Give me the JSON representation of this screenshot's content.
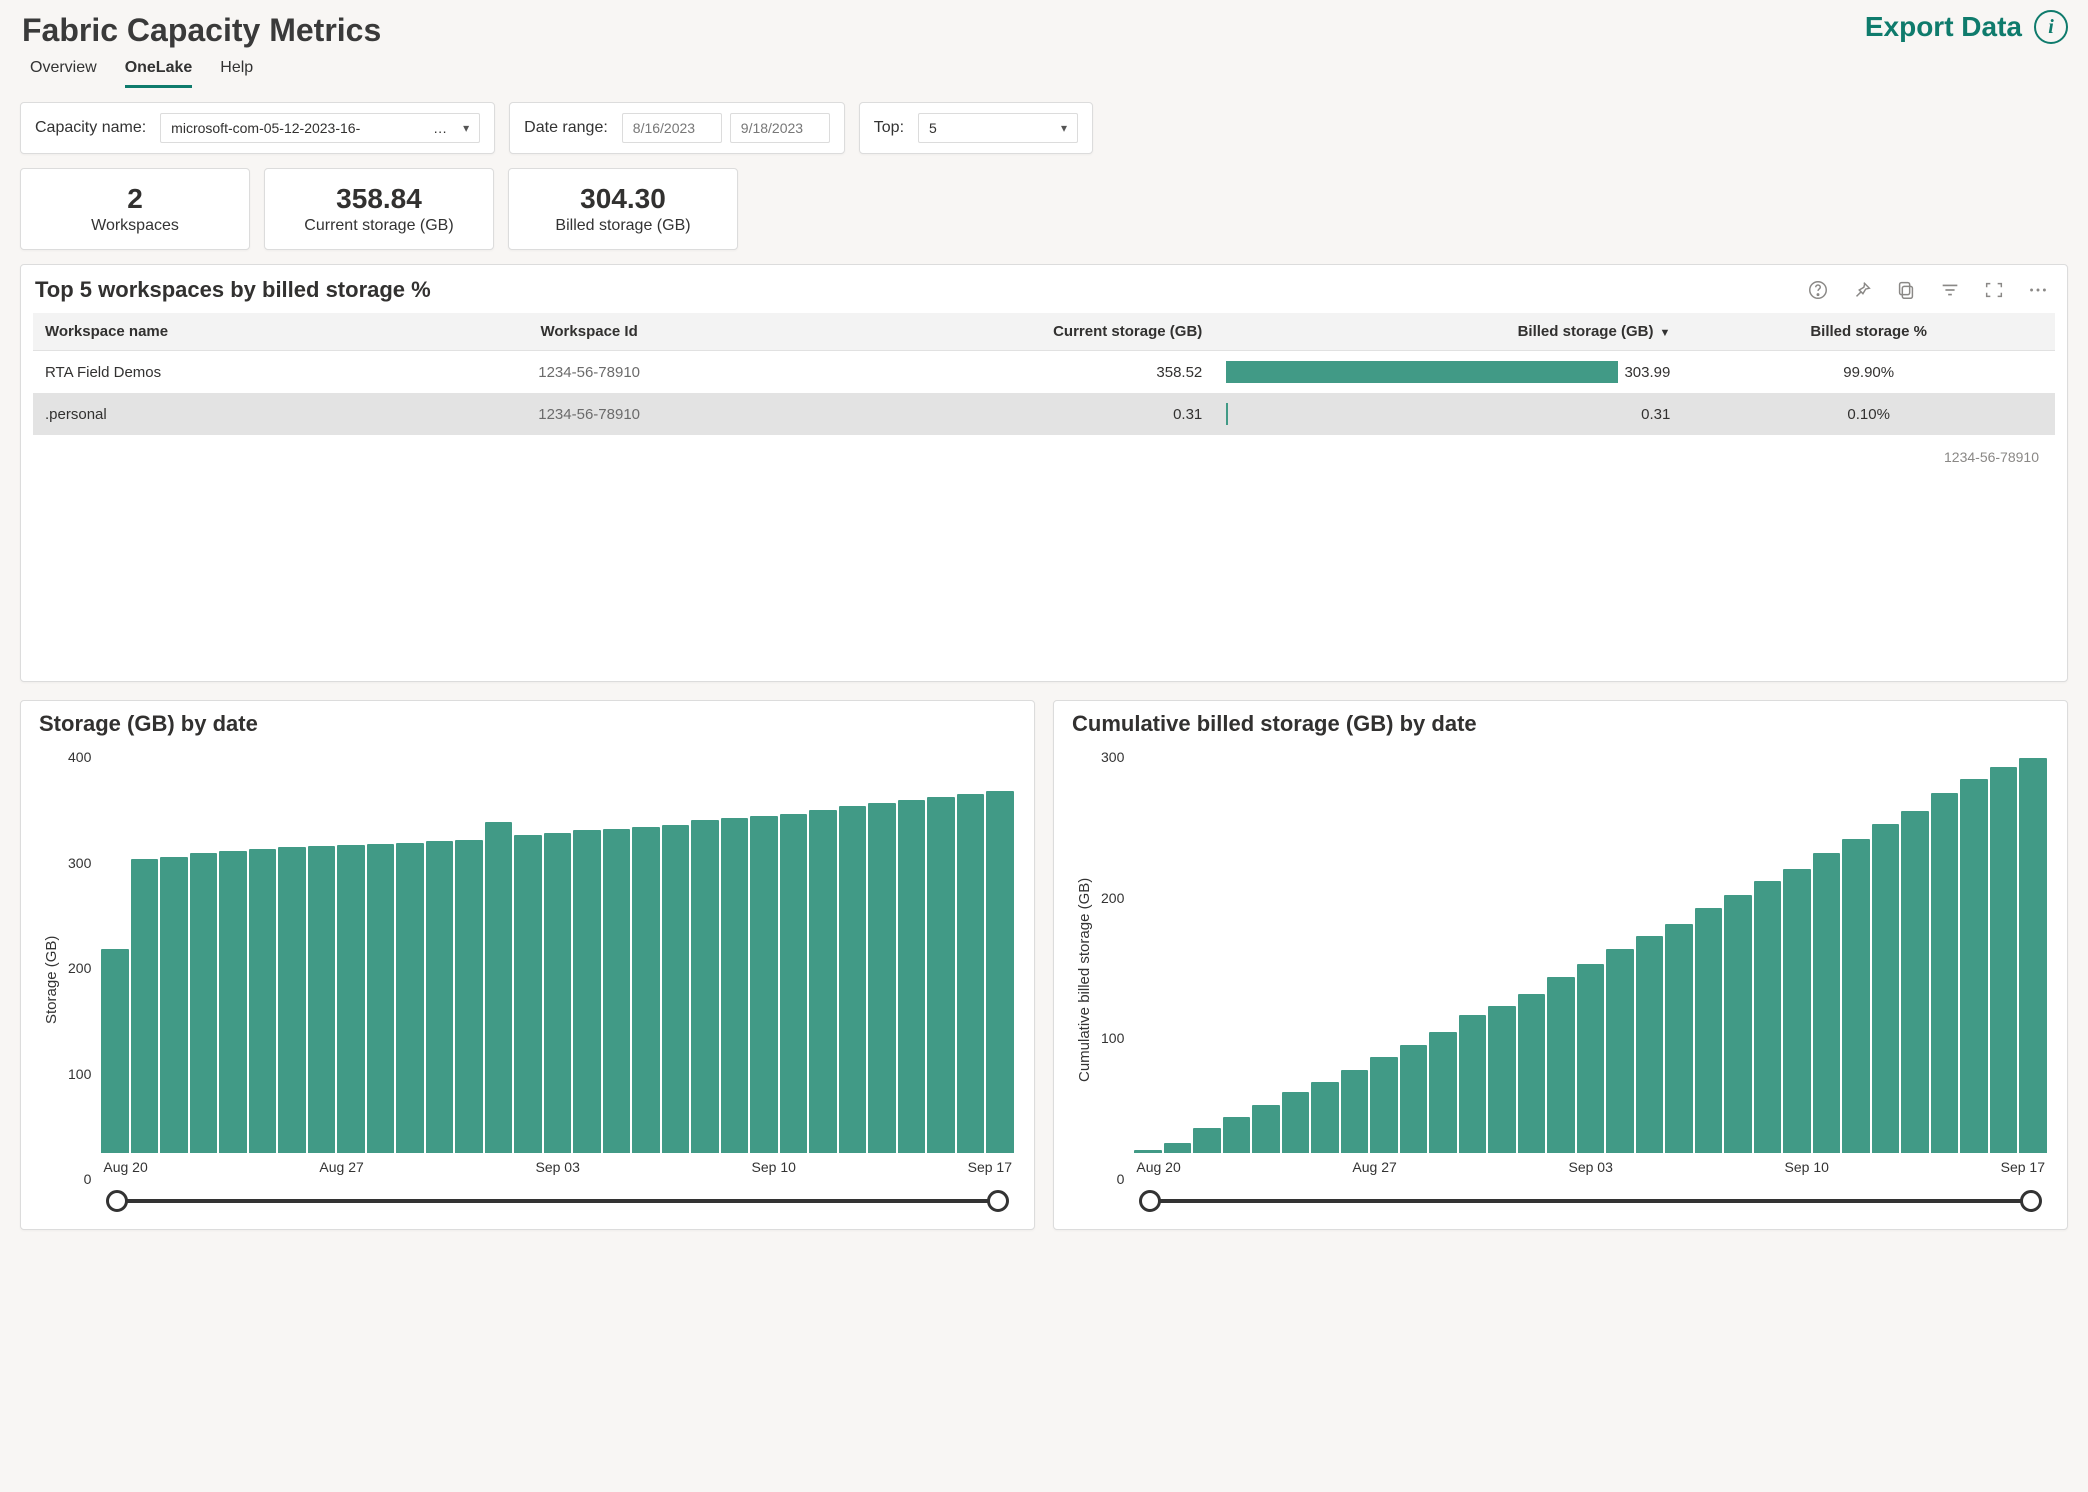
{
  "header": {
    "title": "Fabric Capacity Metrics",
    "export_label": "Export Data"
  },
  "tabs": [
    {
      "label": "Overview",
      "active": false
    },
    {
      "label": "OneLake",
      "active": true
    },
    {
      "label": "Help",
      "active": false
    }
  ],
  "filters": {
    "capacity_label": "Capacity name:",
    "capacity_value": "microsoft-com-05-12-2023-16-",
    "capacity_suffix": "…",
    "date_label": "Date range:",
    "date_start": "8/16/2023",
    "date_end": "9/18/2023",
    "top_label": "Top:",
    "top_value": "5"
  },
  "kpis": [
    {
      "value": "2",
      "label": "Workspaces"
    },
    {
      "value": "358.84",
      "label": "Current storage (GB)"
    },
    {
      "value": "304.30",
      "label": "Billed storage (GB)"
    }
  ],
  "table": {
    "title": "Top 5 workspaces by billed storage %",
    "columns": [
      "Workspace name",
      "Workspace Id",
      "Current storage (GB)",
      "Billed storage (GB)",
      "Billed storage %"
    ],
    "rows": [
      {
        "name": "RTA Field Demos",
        "id": "1234-56-78910",
        "current": "358.52",
        "billed": "303.99",
        "billed_pct": 99.9,
        "pct_label": "99.90%"
      },
      {
        "name": ".personal",
        "id": "1234-56-78910",
        "current": "0.31",
        "billed": "0.31",
        "billed_pct": 0.1,
        "pct_label": "0.10%"
      }
    ],
    "footer_id": "1234-56-78910"
  },
  "chart_data": [
    {
      "type": "bar",
      "title": "Storage (GB) by date",
      "xlabel": "",
      "ylabel": "Storage (GB)",
      "ylim": [
        0,
        400
      ],
      "y_ticks": [
        400,
        300,
        200,
        100,
        0
      ],
      "x_tick_labels": [
        "Aug 20",
        "Aug 27",
        "Sep 03",
        "Sep 10",
        "Sep 17"
      ],
      "categories": [
        "Aug 19",
        "Aug 20",
        "Aug 21",
        "Aug 22",
        "Aug 23",
        "Aug 24",
        "Aug 25",
        "Aug 26",
        "Aug 27",
        "Aug 28",
        "Aug 29",
        "Aug 30",
        "Aug 31",
        "Sep 01",
        "Sep 02",
        "Sep 03",
        "Sep 04",
        "Sep 05",
        "Sep 06",
        "Sep 07",
        "Sep 08",
        "Sep 09",
        "Sep 10",
        "Sep 11",
        "Sep 12",
        "Sep 13",
        "Sep 14",
        "Sep 15",
        "Sep 16",
        "Sep 17",
        "Sep 18"
      ],
      "values": [
        200,
        288,
        290,
        294,
        296,
        298,
        300,
        301,
        302,
        303,
        304,
        306,
        307,
        325,
        312,
        314,
        317,
        318,
        320,
        322,
        326,
        328,
        330,
        332,
        336,
        340,
        343,
        346,
        349,
        352,
        355
      ]
    },
    {
      "type": "bar",
      "title": "Cumulative billed storage (GB) by date",
      "xlabel": "",
      "ylabel": "Cumulative billed storage (GB)",
      "ylim": [
        0,
        320
      ],
      "y_ticks": [
        300,
        200,
        100,
        0
      ],
      "x_tick_labels": [
        "Aug 20",
        "Aug 27",
        "Sep 03",
        "Sep 10",
        "Sep 17"
      ],
      "categories": [
        "Aug 19",
        "Aug 20",
        "Aug 21",
        "Aug 22",
        "Aug 23",
        "Aug 24",
        "Aug 25",
        "Aug 26",
        "Aug 27",
        "Aug 28",
        "Aug 29",
        "Aug 30",
        "Aug 31",
        "Sep 01",
        "Sep 02",
        "Sep 03",
        "Sep 04",
        "Sep 05",
        "Sep 06",
        "Sep 07",
        "Sep 08",
        "Sep 09",
        "Sep 10",
        "Sep 11",
        "Sep 12",
        "Sep 13",
        "Sep 14",
        "Sep 15",
        "Sep 16",
        "Sep 17",
        "Sep 18"
      ],
      "values": [
        2,
        8,
        20,
        28,
        38,
        48,
        56,
        65,
        75,
        85,
        95,
        108,
        115,
        125,
        138,
        148,
        160,
        170,
        180,
        192,
        202,
        213,
        223,
        235,
        246,
        258,
        268,
        282,
        293,
        303,
        310
      ]
    }
  ]
}
